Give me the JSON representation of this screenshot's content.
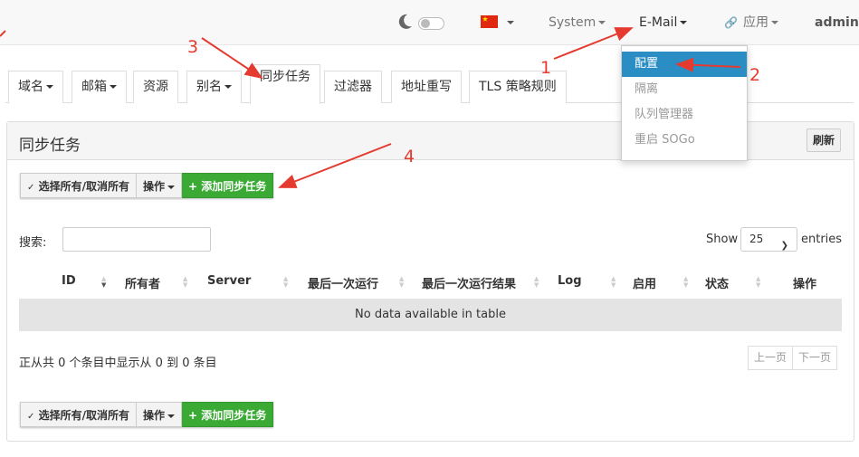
{
  "navbar": {
    "items": [
      {
        "label": "System"
      },
      {
        "label": "E-Mail"
      },
      {
        "label": "应用"
      },
      {
        "label": "admin"
      }
    ]
  },
  "email_menu": {
    "items": [
      {
        "label": "配置",
        "active": true
      },
      {
        "label": "隔离"
      },
      {
        "label": "队列管理器"
      },
      {
        "label": "重启 SOGo"
      }
    ]
  },
  "tabs": [
    {
      "label": "域名",
      "has_caret": true
    },
    {
      "label": "邮箱",
      "has_caret": true
    },
    {
      "label": "资源"
    },
    {
      "label": "别名",
      "has_caret": true
    },
    {
      "label": "同步任务",
      "active": true
    },
    {
      "label": "过滤器"
    },
    {
      "label": "地址重写"
    },
    {
      "label": "TLS 策略规则"
    }
  ],
  "panel": {
    "title": "同步任务",
    "refresh_label": "刷新"
  },
  "toolbar": {
    "select_all_label": "选择所有/取消所有",
    "actions_label": "操作",
    "add_label": "添加同步任务"
  },
  "table": {
    "search_label": "搜索:",
    "search_value": "",
    "show_label": "Show",
    "page_size": "25",
    "entries_label": "entries",
    "columns": [
      "ID",
      "所有者",
      "Server",
      "最后一次运行",
      "最后一次运行结果",
      "Log",
      "启用",
      "状态",
      "操作"
    ],
    "empty_text": "No data available in table",
    "info_text": "正从共 0 个条目中显示从 0 到 0 条目",
    "prev_label": "上一页",
    "next_label": "下一页"
  },
  "annotations": [
    "1",
    "2",
    "3",
    "4"
  ],
  "colors": {
    "accent": "#2a8ec4",
    "add_button": "#3aaa35",
    "annotation": "#e53a2f",
    "flag": "#de2910"
  }
}
